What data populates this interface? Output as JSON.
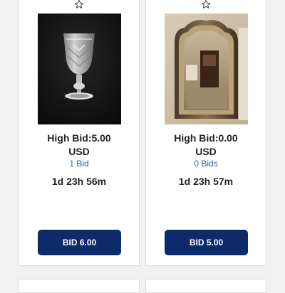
{
  "items": [
    {
      "high_bid_line": "High Bid:5.00",
      "currency": "USD",
      "bids": "1 Bid",
      "time_left": "1d 23h 56m",
      "bid_button": "BID 6.00"
    },
    {
      "high_bid_line": "High Bid:0.00",
      "currency": "USD",
      "bids": "0 Bids",
      "time_left": "1d 23h 57m",
      "bid_button": "BID 5.00"
    }
  ],
  "icons": {
    "watch": "star-outline-icon"
  },
  "colors": {
    "button_bg": "#0d2b6b",
    "bids_link": "#2c5d9c",
    "page_bg": "#f1f1f2"
  }
}
